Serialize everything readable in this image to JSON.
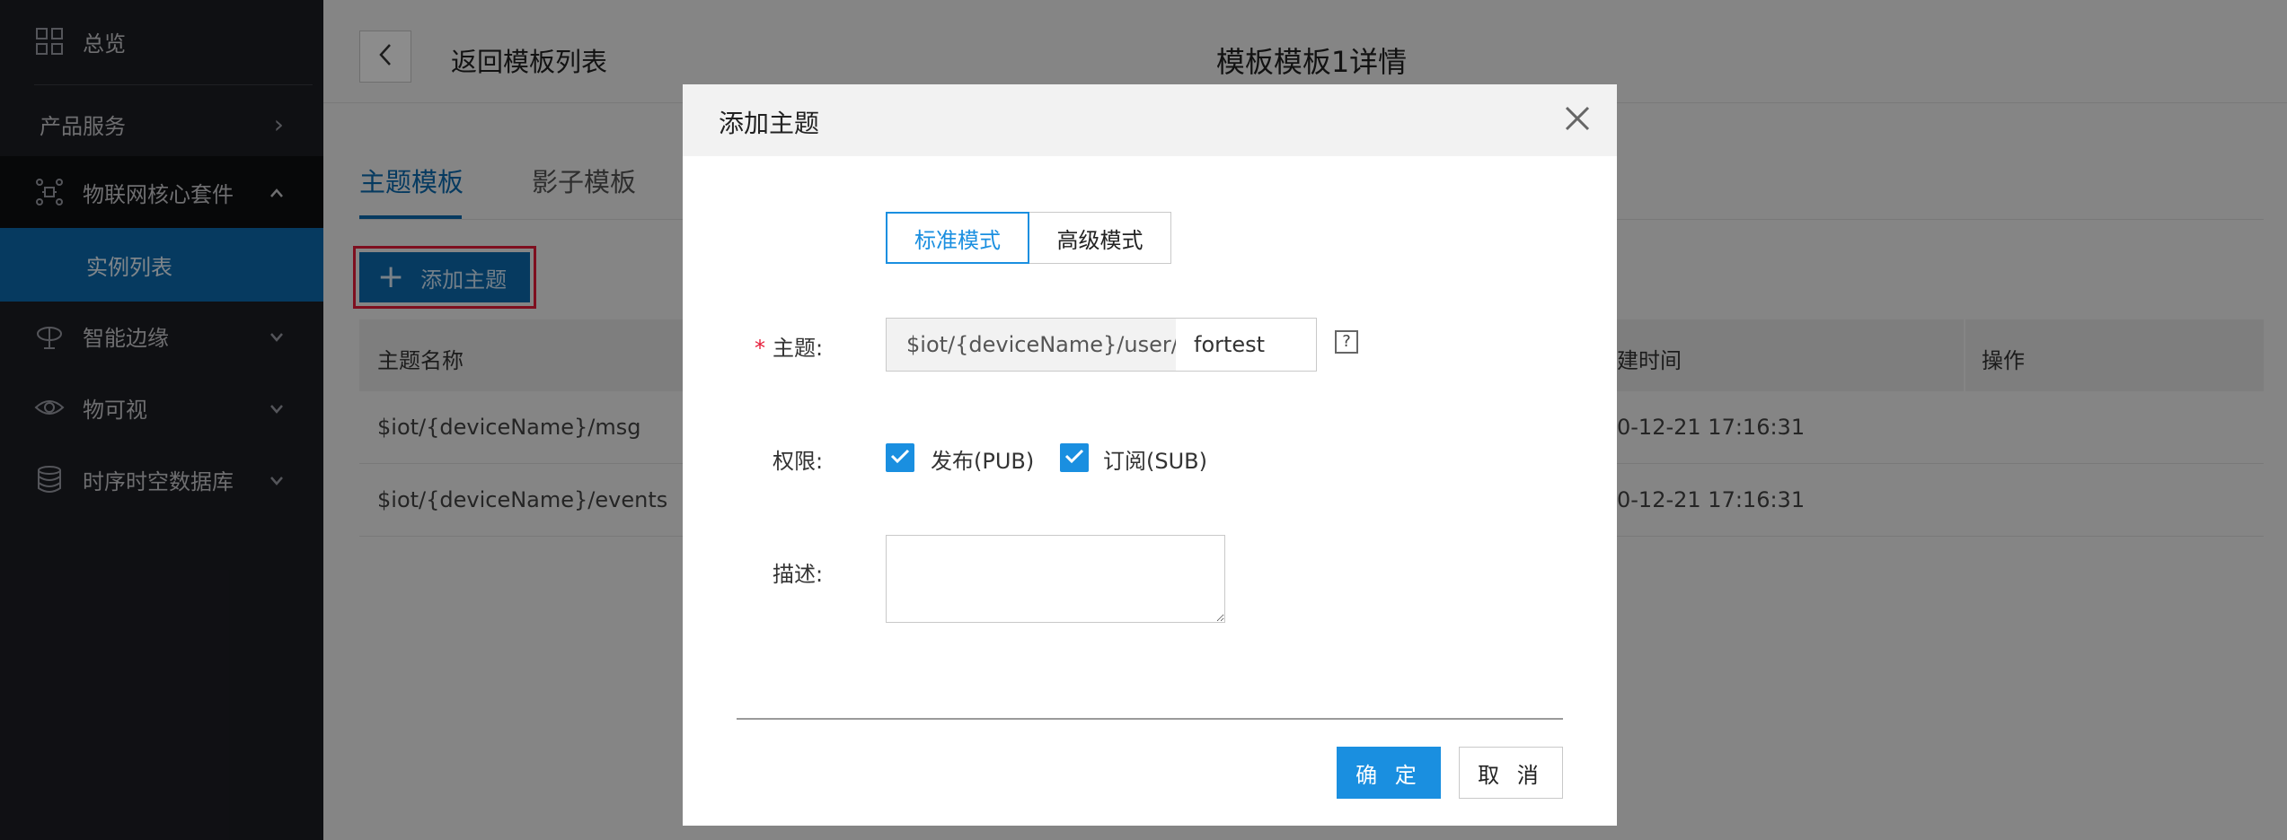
{
  "sidebar": {
    "items": [
      {
        "label": "总览",
        "icon": "grid-icon"
      },
      {
        "label": "产品服务",
        "icon": "chevron-right-icon"
      },
      {
        "label": "物联网核心套件",
        "icon": "iot-core-icon"
      },
      {
        "label": "实例列表"
      },
      {
        "label": "智能边缘",
        "icon": "edge-icon"
      },
      {
        "label": "物可视",
        "icon": "eye-icon"
      },
      {
        "label": "时序时空数据库",
        "icon": "database-icon"
      }
    ]
  },
  "header": {
    "back_label": "返回模板列表",
    "title": "模板模板1详情"
  },
  "tabs": [
    {
      "label": "主题模板",
      "active": true
    },
    {
      "label": "影子模板",
      "active": false
    }
  ],
  "toolbar": {
    "add_label": "添加主题"
  },
  "table": {
    "columns": [
      "主题名称",
      "建时间",
      "操作"
    ],
    "rows": [
      {
        "name": "$iot/{deviceName}/msg",
        "time": "0-12-21 17:16:31"
      },
      {
        "name": "$iot/{deviceName}/events",
        "time": "0-12-21 17:16:31"
      }
    ]
  },
  "modal": {
    "title": "添加主题",
    "mode_standard": "标准模式",
    "mode_advanced": "高级模式",
    "topic_label": "主题:",
    "topic_required_mark": "*",
    "topic_prefix": "$iot/{deviceName}/user/",
    "topic_value": "fortest",
    "topic_help": "?",
    "perm_label": "权限:",
    "perm_pub": "发布(PUB)",
    "perm_sub": "订阅(SUB)",
    "perm_pub_checked": true,
    "perm_sub_checked": true,
    "desc_label": "描述:",
    "desc_value": "",
    "ok_label": "确 定",
    "cancel_label": "取 消"
  },
  "colors": {
    "accent": "#1a8fe0",
    "brand_dark": "#0b6bb0",
    "highlight_outline": "#e61d3a",
    "sidebar_bg": "#1d1e24"
  }
}
